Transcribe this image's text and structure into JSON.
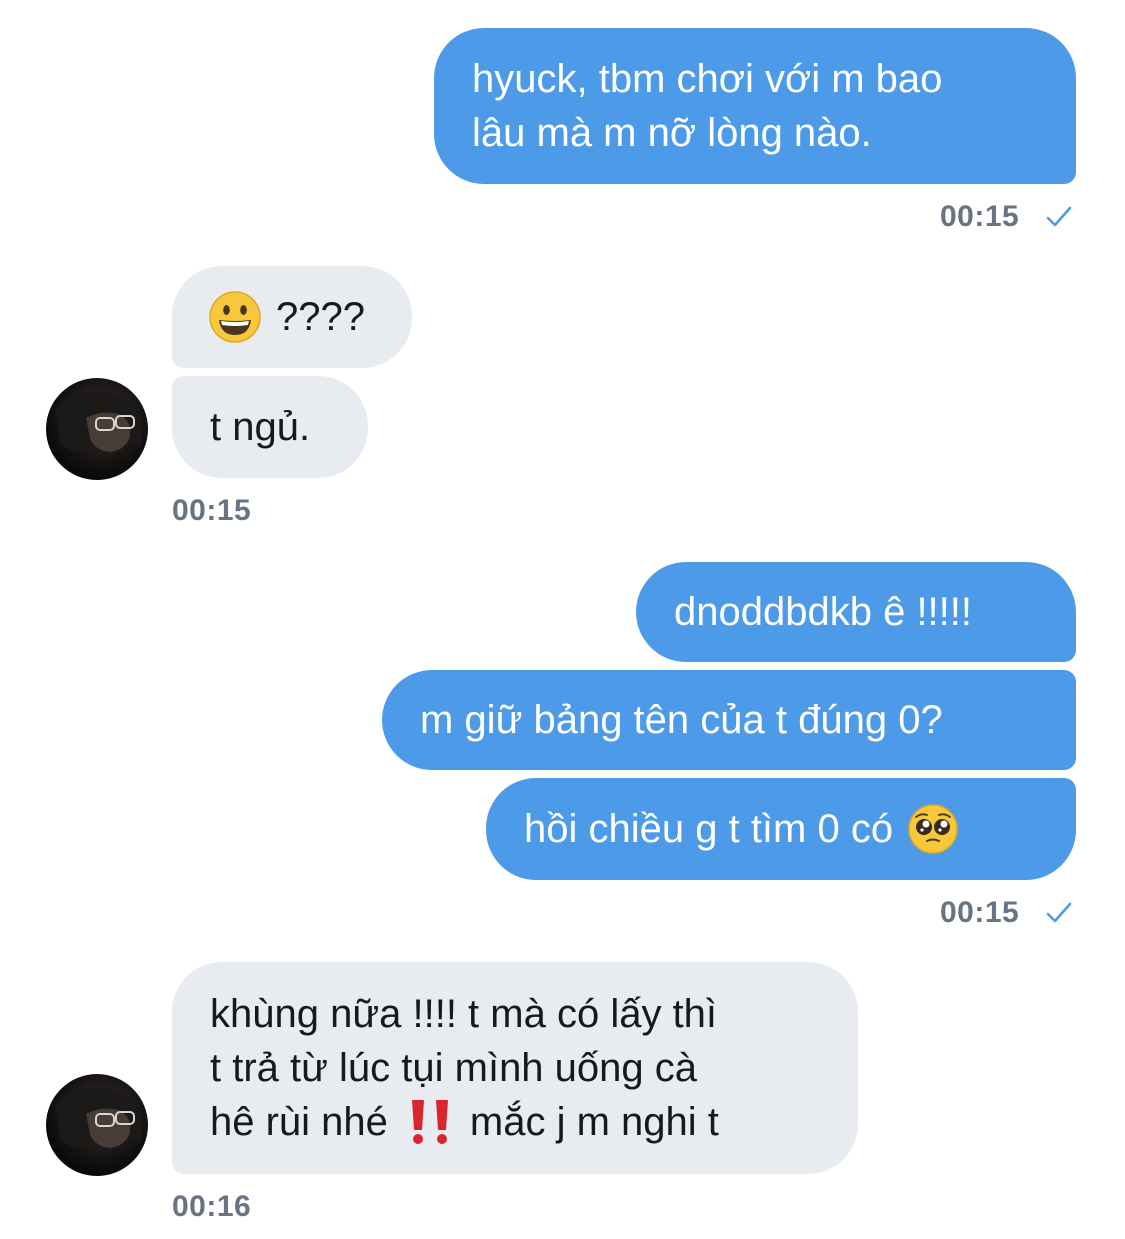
{
  "messages": [
    {
      "side": "out",
      "lines": [
        "hyuck, tbm chơi với m bao",
        "lâu mà m nỡ lòng nào."
      ]
    },
    {
      "side": "in",
      "text": "????",
      "emoji": "grinning-face-icon"
    },
    {
      "side": "in",
      "text": "t ngủ."
    },
    {
      "side": "out",
      "text": "dnoddbdkb ê !!!!!"
    },
    {
      "side": "out",
      "text": "m giữ bảng tên của t đúng 0?"
    },
    {
      "side": "out",
      "text": "hồi chiều g t tìm 0 có",
      "emoji": "pleading-face-icon"
    },
    {
      "side": "in",
      "lines": [
        "khùng nữa !!!! t mà có lấy thì",
        "t trả từ lúc tụi mình uống cà",
        "hê rùi nhé",
        "mắc j m nghi t"
      ],
      "emoji": "double-exclamation-icon"
    }
  ],
  "timestamps": {
    "t1": "00:15",
    "t2": "00:15",
    "t3": "00:15",
    "t4": "00:16"
  },
  "colors": {
    "outgoing_bubble": "#4d9be8",
    "incoming_bubble": "#e8ebf0",
    "timestamp": "#687483",
    "read_check": "#4d9be8"
  }
}
